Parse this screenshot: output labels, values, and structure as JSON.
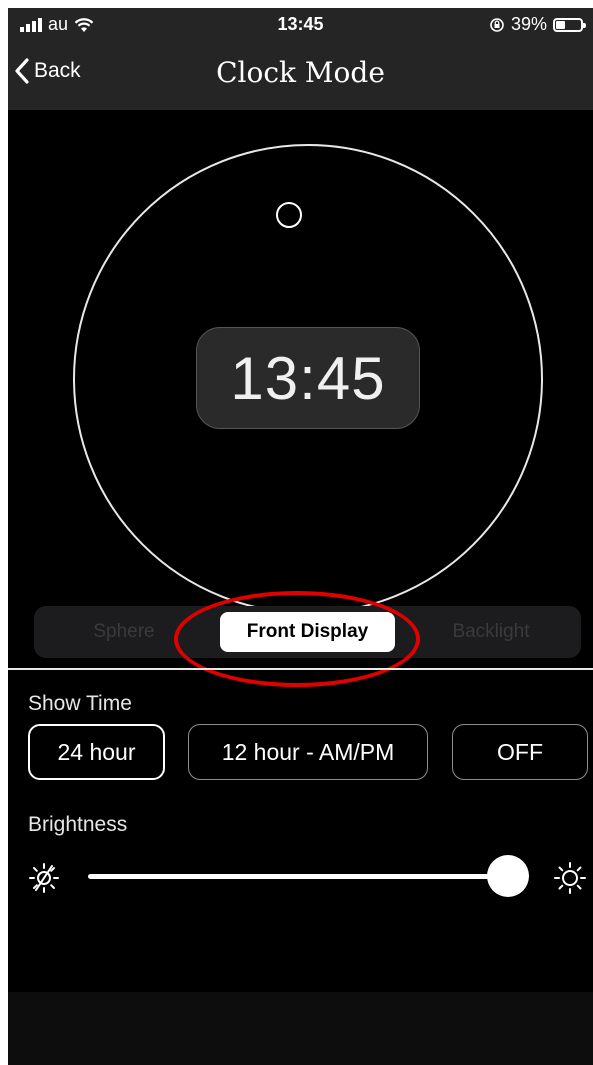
{
  "status_bar": {
    "carrier": "au",
    "time": "13:45",
    "battery": "39%"
  },
  "nav": {
    "back_label": "Back",
    "title": "Clock Mode"
  },
  "clock": {
    "display_time": "13:45"
  },
  "tabs": [
    {
      "label": "Sphere",
      "selected": false
    },
    {
      "label": "Front Display",
      "selected": true
    },
    {
      "label": "Backlight",
      "selected": false
    }
  ],
  "show_time": {
    "label": "Show Time",
    "options": [
      "24 hour",
      "12 hour - AM/PM",
      "OFF"
    ],
    "selected": "24 hour"
  },
  "brightness": {
    "label": "Brightness",
    "value": 1.0
  },
  "icons": {
    "back": "chevron-left-icon",
    "brightness_low": "brightness-off-icon",
    "brightness_high": "brightness-high-icon",
    "wifi": "wifi-icon",
    "rotation_lock": "rotation-lock-icon"
  },
  "colors": {
    "highlight_annotation": "#e00000",
    "background": "#000000",
    "nav_bar": "#252525"
  }
}
